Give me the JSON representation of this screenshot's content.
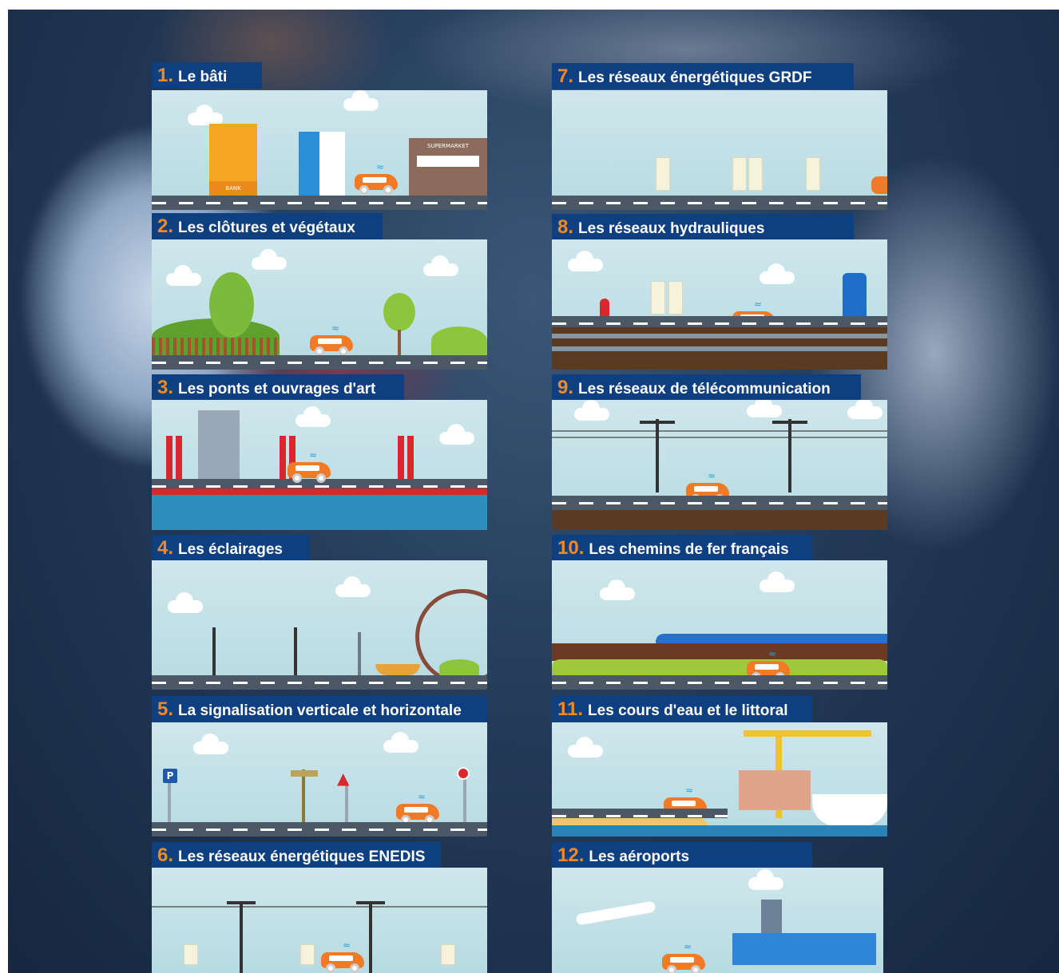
{
  "sections": [
    {
      "num": "1.",
      "label": "Le bâti"
    },
    {
      "num": "2.",
      "label": "Les clôtures et végétaux"
    },
    {
      "num": "3.",
      "label": "Les ponts et ouvrages d'art"
    },
    {
      "num": "4.",
      "label": "Les éclairages"
    },
    {
      "num": "5.",
      "label": "La signalisation verticale et horizontale"
    },
    {
      "num": "6.",
      "label": "Les réseaux énergétiques ENEDIS"
    },
    {
      "num": "7.",
      "label": "Les réseaux énergétiques GRDF"
    },
    {
      "num": "8.",
      "label": "Les réseaux hydrauliques"
    },
    {
      "num": "9.",
      "label": "Les réseaux de télécommunication"
    },
    {
      "num": "10.",
      "label": "Les chemins de fer français"
    },
    {
      "num": "11.",
      "label": "Les cours d'eau et le littoral"
    },
    {
      "num": "12.",
      "label": "Les aéroports"
    }
  ],
  "signage": {
    "bank": "BANK",
    "supermarket": "SUPERMARKET",
    "parking": "P"
  },
  "colors": {
    "title_bg": "#0e3f80",
    "number": "#f08a24",
    "car": "#f07a26",
    "sky": "#c6e3e8",
    "road": "#4d5866"
  }
}
